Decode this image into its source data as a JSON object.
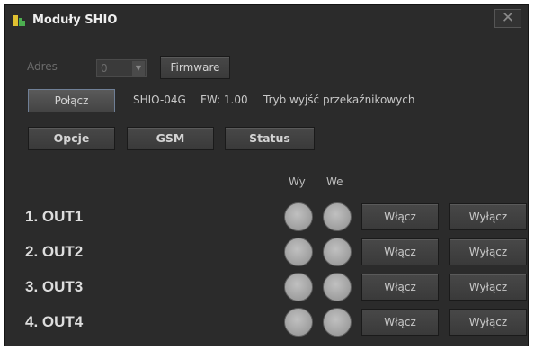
{
  "window": {
    "title": "Moduły SHIO",
    "close_label": "✕"
  },
  "address": {
    "label": "Adres",
    "value": "0"
  },
  "buttons": {
    "firmware": "Firmware",
    "connect": "Połącz",
    "options": "Opcje",
    "gsm": "GSM",
    "status": "Status"
  },
  "device_info": {
    "model": "SHIO-04G",
    "firmware": "FW: 1.00",
    "mode": "Tryb wyjść przekaźnikowych"
  },
  "columns": {
    "outputs": "Wy",
    "inputs": "We"
  },
  "outputs": [
    {
      "label": "1. OUT1",
      "on_label": "Włącz",
      "off_label": "Wyłącz"
    },
    {
      "label": "2. OUT2",
      "on_label": "Włącz",
      "off_label": "Wyłącz"
    },
    {
      "label": "3. OUT3",
      "on_label": "Włącz",
      "off_label": "Wyłącz"
    },
    {
      "label": "4. OUT4",
      "on_label": "Włącz",
      "off_label": "Wyłącz"
    }
  ],
  "colors": {
    "background": "#2b2b2b",
    "led_off": "#a8a8a8",
    "icon_yellow": "#e0c030",
    "icon_green": "#4caf50"
  }
}
